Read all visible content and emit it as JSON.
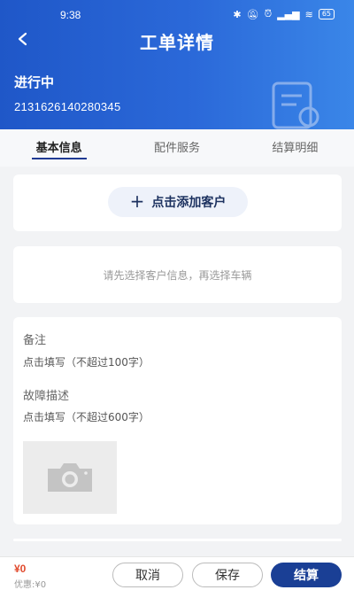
{
  "status_bar": {
    "time": "9:38",
    "battery": "65"
  },
  "header": {
    "title": "工单详情",
    "status": "进行中",
    "order_number": "2131626140280345"
  },
  "tabs": [
    {
      "label": "基本信息",
      "active": true
    },
    {
      "label": "配件服务",
      "active": false
    },
    {
      "label": "结算明细",
      "active": false
    }
  ],
  "customer": {
    "add_label": "点击添加客户"
  },
  "vehicle": {
    "hint": "请先选择客户信息，再选择车辆"
  },
  "remarks": {
    "label": "备注",
    "placeholder": "点击填写（不超过100字）"
  },
  "fault": {
    "label": "故障描述",
    "placeholder": "点击填写（不超过600字）"
  },
  "footer": {
    "price": "¥0",
    "discount": "优惠:¥0",
    "cancel_label": "取消",
    "save_label": "保存",
    "settle_label": "结算"
  },
  "colors": {
    "header_gradient_start": "#1f57c8",
    "header_gradient_end": "#3a86e8",
    "primary_button": "#1a3f95",
    "price": "#e14b2e"
  }
}
